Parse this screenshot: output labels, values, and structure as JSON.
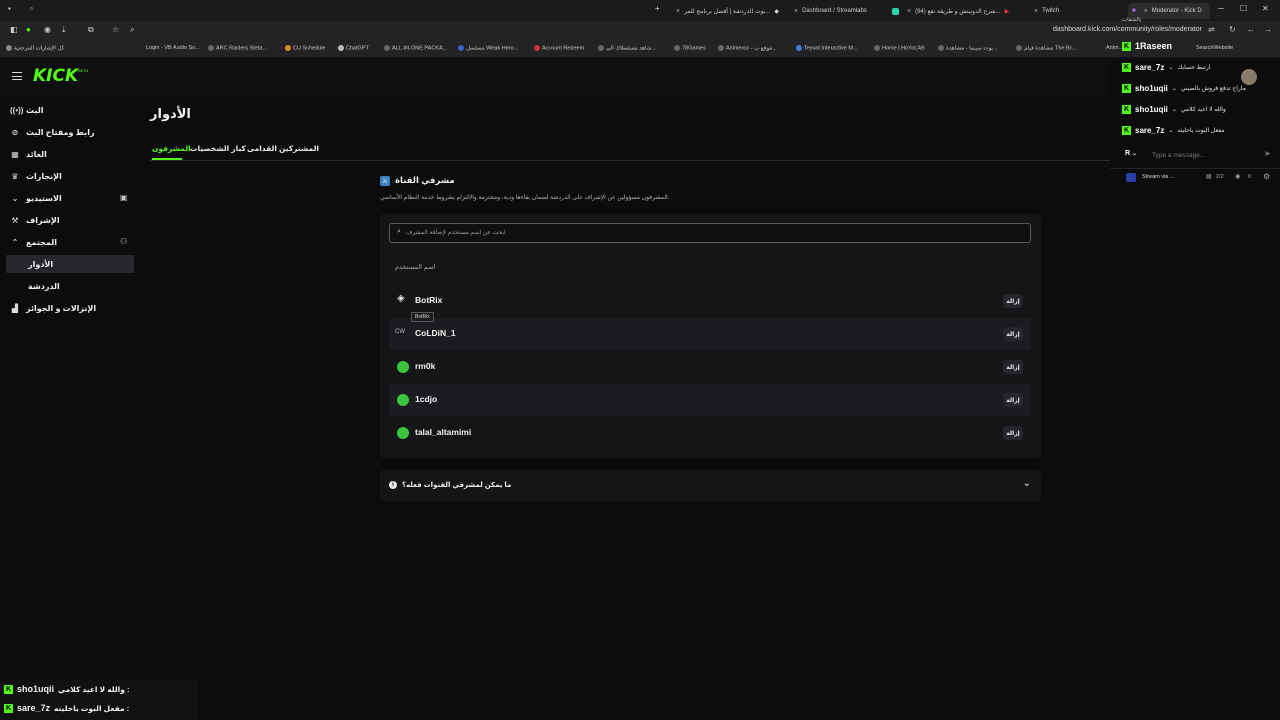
{
  "browser": {
    "tabs": [
      {
        "label": "بوت الدردشة | أفضل برنامج للمر..."
      },
      {
        "label": "Dashboard / Streamlabs"
      },
      {
        "label": "(94) شرح الدونيتش و طريقة تفع..."
      },
      {
        "label": "Twitch"
      },
      {
        "label": "Moderator - Kick D"
      }
    ],
    "url": "dashboard.kick.com/community/roles/moderator",
    "bookmarks": [
      "كل الإشارات المرجعية",
      "Login - VB Audio So...",
      "ARC Raiders Steta...",
      "CU Schedule",
      "ChatGPT",
      "ALL-IN-ONE PACKA...",
      "مسلسل Weak Hero...",
      "Account Redeem",
      "شاهد مسلسلاك الي...",
      "78Games",
      "Animerco - موقع ب...",
      "Teyvat Interactive M...",
      "Home | HoYoLAB",
      "بوت سينما - مشاهدة...",
      "مشاهدة فيلم The Br...",
      "Anim...",
      "SearchWebsite"
    ]
  },
  "app": {
    "logo": "KICK",
    "logo_badge": "BETA"
  },
  "sidebar": {
    "items": [
      {
        "label": "البث",
        "icon": "broadcast-icon"
      },
      {
        "label": "رابط ومفتاح البث",
        "icon": "link-icon"
      },
      {
        "label": "العائد",
        "icon": "revenue-icon"
      },
      {
        "label": "الإنجازات",
        "icon": "trophy-icon"
      },
      {
        "label": "الاستيديو",
        "icon": "studio-icon"
      },
      {
        "label": "الإشراف",
        "icon": "moderation-icon"
      },
      {
        "label": "المجتمع",
        "icon": "community-icon"
      },
      {
        "label": "الأدوار",
        "icon": ""
      },
      {
        "label": "الدردشة",
        "icon": ""
      },
      {
        "label": "الإنزالات و الجوائز",
        "icon": "drops-icon"
      }
    ]
  },
  "main": {
    "page_title": "الأدوار",
    "tabs": [
      {
        "label": "المشرفون"
      },
      {
        "label": "كبار الشخصيات"
      },
      {
        "label": "المشتركين القدامى"
      }
    ],
    "section_title": "مشرفي القناة",
    "section_desc": "المشرفون مسؤولين عن الإشراف على الدردشة لضمان بقاءها ودية، ومحترمة والالتزام بشروط خدمة النظام الأساسي.",
    "search_placeholder": "ابحث عن اسم مستخدم لإضافة المشرف",
    "column_header": "اسم المستخدم",
    "moderators": [
      {
        "name": "BotRix",
        "avatar_color": "#e8e8e8"
      },
      {
        "name": "CoLDiN_1",
        "avatar_color": "#bbbbbb"
      },
      {
        "name": "rm0k",
        "avatar_color": "#3cc43c"
      },
      {
        "name": "1cdjo",
        "avatar_color": "#3cc43c"
      },
      {
        "name": "talal_altamimi",
        "avatar_color": "#3cc43c"
      }
    ],
    "remove_label": "إزالة",
    "tooltip": "BotRix",
    "faq_label": "ما يمكن لمشرفي القنوات فعله؟"
  },
  "chat": {
    "header_user": "1Raseen",
    "header_sub": "يالشفات",
    "messages": [
      {
        "user": "sare_7z",
        "text": "ارتبط حسابك"
      },
      {
        "user": "sho1uqii",
        "text": "ماراح تدفع فروش بالصيني"
      },
      {
        "user": "sho1uqii",
        "text": "والله لا اعيد كلامي"
      },
      {
        "user": "sare_7z",
        "text": "مفعل البوت ياحليته"
      }
    ],
    "input_initial": "R",
    "input_placeholder": "Type a message...",
    "status_text": "Stream via ...",
    "viewer_ratio": "2/2",
    "viewers": "0"
  },
  "overlay": {
    "messages": [
      {
        "user": "sho1uqii",
        "text": "والله لا اعيد كلامي :"
      },
      {
        "user": "sare_7z",
        "text": "مفعل البوت ياحليته :"
      }
    ]
  },
  "colors": {
    "accent": "#53fc18",
    "background": "#0c0c0d",
    "panel": "#141517"
  }
}
